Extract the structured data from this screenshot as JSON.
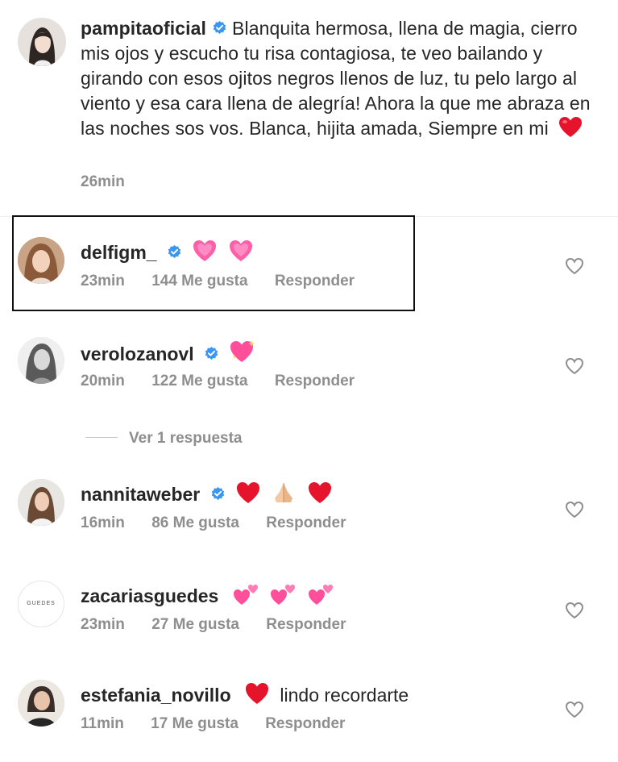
{
  "caption": {
    "username": "pampitaoficial",
    "text": "Blanquita hermosa, llena de magia, cierro mis ojos y escucho tu risa contagiosa, te veo bailando y girando con esos ojitos negros llenos de luz, tu pelo largo al viento y esa cara llena de alegría! Ahora la que me abraza en las noches sos vos. Blanca, hijita amada, Siempre en mi",
    "emoji": "red-heart",
    "time": "26min"
  },
  "comments": [
    {
      "username": "delfigm_",
      "verified": true,
      "text": "",
      "emojis": [
        "growing-heart",
        "growing-heart"
      ],
      "time": "23min",
      "likes": "144 Me gusta",
      "reply": "Responder"
    },
    {
      "username": "verolozanovl",
      "verified": true,
      "text": "",
      "emojis": [
        "sparkling-heart"
      ],
      "time": "20min",
      "likes": "122 Me gusta",
      "reply": "Responder"
    },
    {
      "username": "nannitaweber",
      "verified": true,
      "text": "",
      "emojis": [
        "red-heart",
        "folded-hands",
        "red-heart"
      ],
      "time": "16min",
      "likes": "86 Me gusta",
      "reply": "Responder"
    },
    {
      "username": "zacariasguedes",
      "verified": false,
      "avatar_text": "GUEDES",
      "text": "",
      "emojis": [
        "two-hearts",
        "two-hearts",
        "two-hearts"
      ],
      "time": "23min",
      "likes": "27 Me gusta",
      "reply": "Responder"
    },
    {
      "username": "estefania_novillo",
      "verified": false,
      "text": "lindo recordarte",
      "emojis": [
        "red-heart"
      ],
      "time": "11min",
      "likes": "17 Me gusta",
      "reply": "Responder"
    }
  ],
  "view_replies": "Ver 1 respuesta",
  "colors": {
    "text": "#262626",
    "secondary": "#8e8e8e",
    "verified": "#3897f0",
    "heart_red": "#e5132b",
    "pink": "#ff4f9a"
  }
}
